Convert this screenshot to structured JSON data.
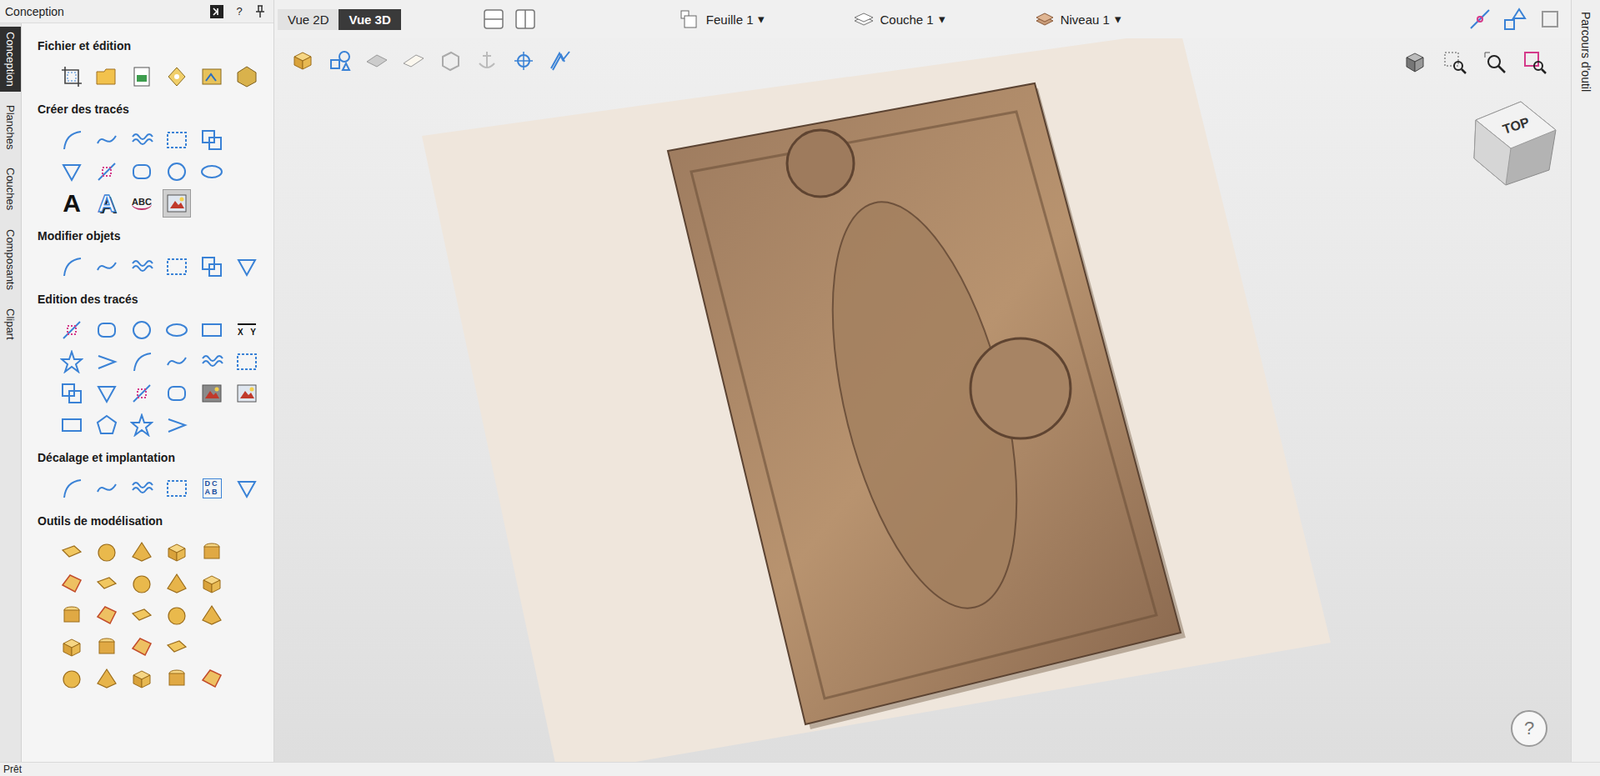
{
  "left_panel": {
    "title": "Conception",
    "help": "?",
    "side_tabs": [
      {
        "label": "Conception",
        "selected": true
      },
      {
        "label": "Planches",
        "selected": false
      },
      {
        "label": "Couches",
        "selected": false
      },
      {
        "label": "Composants",
        "selected": false
      },
      {
        "label": "Clipart",
        "selected": false
      }
    ],
    "sections": [
      {
        "title": "Fichier et édition",
        "rows": [
          [
            {
              "kind": "file",
              "selected": false
            },
            {
              "kind": "file",
              "selected": false
            },
            {
              "kind": "file",
              "selected": false
            },
            {
              "kind": "file",
              "selected": false
            },
            {
              "kind": "file",
              "selected": false
            },
            {
              "kind": "file",
              "selected": false
            }
          ]
        ]
      },
      {
        "title": "Créer des tracés",
        "rows": [
          [
            {
              "kind": "outline",
              "selected": false
            },
            {
              "kind": "outline",
              "selected": false
            },
            {
              "kind": "outline",
              "selected": false
            },
            {
              "kind": "outline",
              "selected": false
            },
            {
              "kind": "outline",
              "selected": false
            }
          ],
          [
            {
              "kind": "outline",
              "selected": false
            },
            {
              "kind": "outline",
              "selected": false
            },
            {
              "kind": "outline",
              "selected": false
            },
            {
              "kind": "outline",
              "selected": false
            },
            {
              "kind": "outline",
              "selected": false
            }
          ],
          [
            {
              "kind": "text",
              "label": "A",
              "selected": false
            },
            {
              "kind": "outlinetext",
              "label": "A",
              "selected": false
            },
            {
              "kind": "arctext",
              "label": "ABC",
              "selected": false
            },
            {
              "kind": "image",
              "selected": true
            }
          ]
        ]
      },
      {
        "title": "Modifier objets",
        "rows": [
          [
            {
              "kind": "outline",
              "selected": false
            },
            {
              "kind": "outline",
              "selected": false
            },
            {
              "kind": "outline",
              "selected": false
            },
            {
              "kind": "outline",
              "selected": false
            },
            {
              "kind": "outline",
              "selected": false
            },
            {
              "kind": "outline",
              "selected": false
            }
          ]
        ]
      },
      {
        "title": "Edition des tracés",
        "rows": [
          [
            {
              "kind": "outline",
              "selected": false
            },
            {
              "kind": "outline",
              "selected": false
            },
            {
              "kind": "outline",
              "selected": false
            },
            {
              "kind": "outline",
              "selected": false
            },
            {
              "kind": "outline",
              "selected": false
            },
            {
              "kind": "dimension",
              "label": "X Y",
              "selected": false
            }
          ],
          [
            {
              "kind": "outline",
              "selected": false
            },
            {
              "kind": "outline",
              "selected": false
            },
            {
              "kind": "outline",
              "selected": false
            },
            {
              "kind": "outline",
              "selected": false
            },
            {
              "kind": "outline",
              "selected": false
            },
            {
              "kind": "outline",
              "selected": false
            }
          ],
          [
            {
              "kind": "outline",
              "selected": false
            },
            {
              "kind": "outline",
              "selected": false
            },
            {
              "kind": "outline",
              "selected": false
            },
            {
              "kind": "outline",
              "selected": false
            },
            {
              "kind": "image",
              "selected": false
            },
            {
              "kind": "image",
              "selected": false
            }
          ],
          [
            {
              "kind": "outline",
              "selected": false
            },
            {
              "kind": "outline",
              "selected": false
            },
            {
              "kind": "outline",
              "selected": false
            },
            {
              "kind": "outline",
              "selected": false
            }
          ]
        ]
      },
      {
        "title": "Décalage et implantation",
        "rows": [
          [
            {
              "kind": "outline",
              "selected": false
            },
            {
              "kind": "outline",
              "selected": false
            },
            {
              "kind": "outline",
              "selected": false
            },
            {
              "kind": "outline",
              "selected": false
            },
            {
              "kind": "grid",
              "lines": [
                "DC",
                "AB"
              ],
              "selected": false
            },
            {
              "kind": "outline",
              "selected": false
            }
          ]
        ]
      },
      {
        "title": "Outils de modélisation",
        "rows": [
          [
            {
              "kind": "solid",
              "selected": false
            },
            {
              "kind": "solid",
              "selected": false
            },
            {
              "kind": "solid",
              "selected": false
            },
            {
              "kind": "solid",
              "selected": false
            },
            {
              "kind": "solid",
              "selected": false
            }
          ],
          [
            {
              "kind": "solid",
              "selected": false
            },
            {
              "kind": "solid",
              "selected": false
            },
            {
              "kind": "solid",
              "selected": false
            },
            {
              "kind": "solid",
              "selected": false
            },
            {
              "kind": "solid",
              "selected": false
            }
          ],
          [
            {
              "kind": "solid",
              "selected": false
            },
            {
              "kind": "solid",
              "selected": false
            },
            {
              "kind": "solid",
              "selected": false
            },
            {
              "kind": "solid",
              "selected": false
            },
            {
              "kind": "solid",
              "selected": false
            }
          ],
          [
            {
              "kind": "solid",
              "selected": false
            },
            {
              "kind": "solid",
              "selected": false
            },
            {
              "kind": "solid",
              "selected": false
            },
            {
              "kind": "solid",
              "selected": false
            }
          ],
          [
            {
              "kind": "solid",
              "selected": false
            },
            {
              "kind": "solid",
              "selected": false
            },
            {
              "kind": "solid",
              "selected": false
            },
            {
              "kind": "solid",
              "selected": false
            },
            {
              "kind": "solid",
              "selected": false
            }
          ]
        ]
      }
    ]
  },
  "toolbar": {
    "view_tabs": [
      {
        "label": "Vue 2D",
        "selected": false
      },
      {
        "label": "Vue 3D",
        "selected": true
      }
    ],
    "dropdowns": [
      {
        "label": "Feuille 1",
        "caret": "▾"
      },
      {
        "label": "Couche 1",
        "caret": "▾"
      },
      {
        "label": "Niveau 1",
        "caret": "▾"
      }
    ]
  },
  "view": {
    "cube_label": "TOP",
    "help": "?"
  },
  "right_tab": {
    "label": "Parcours d'outil"
  },
  "status_bar": {
    "text": "Prêt"
  }
}
